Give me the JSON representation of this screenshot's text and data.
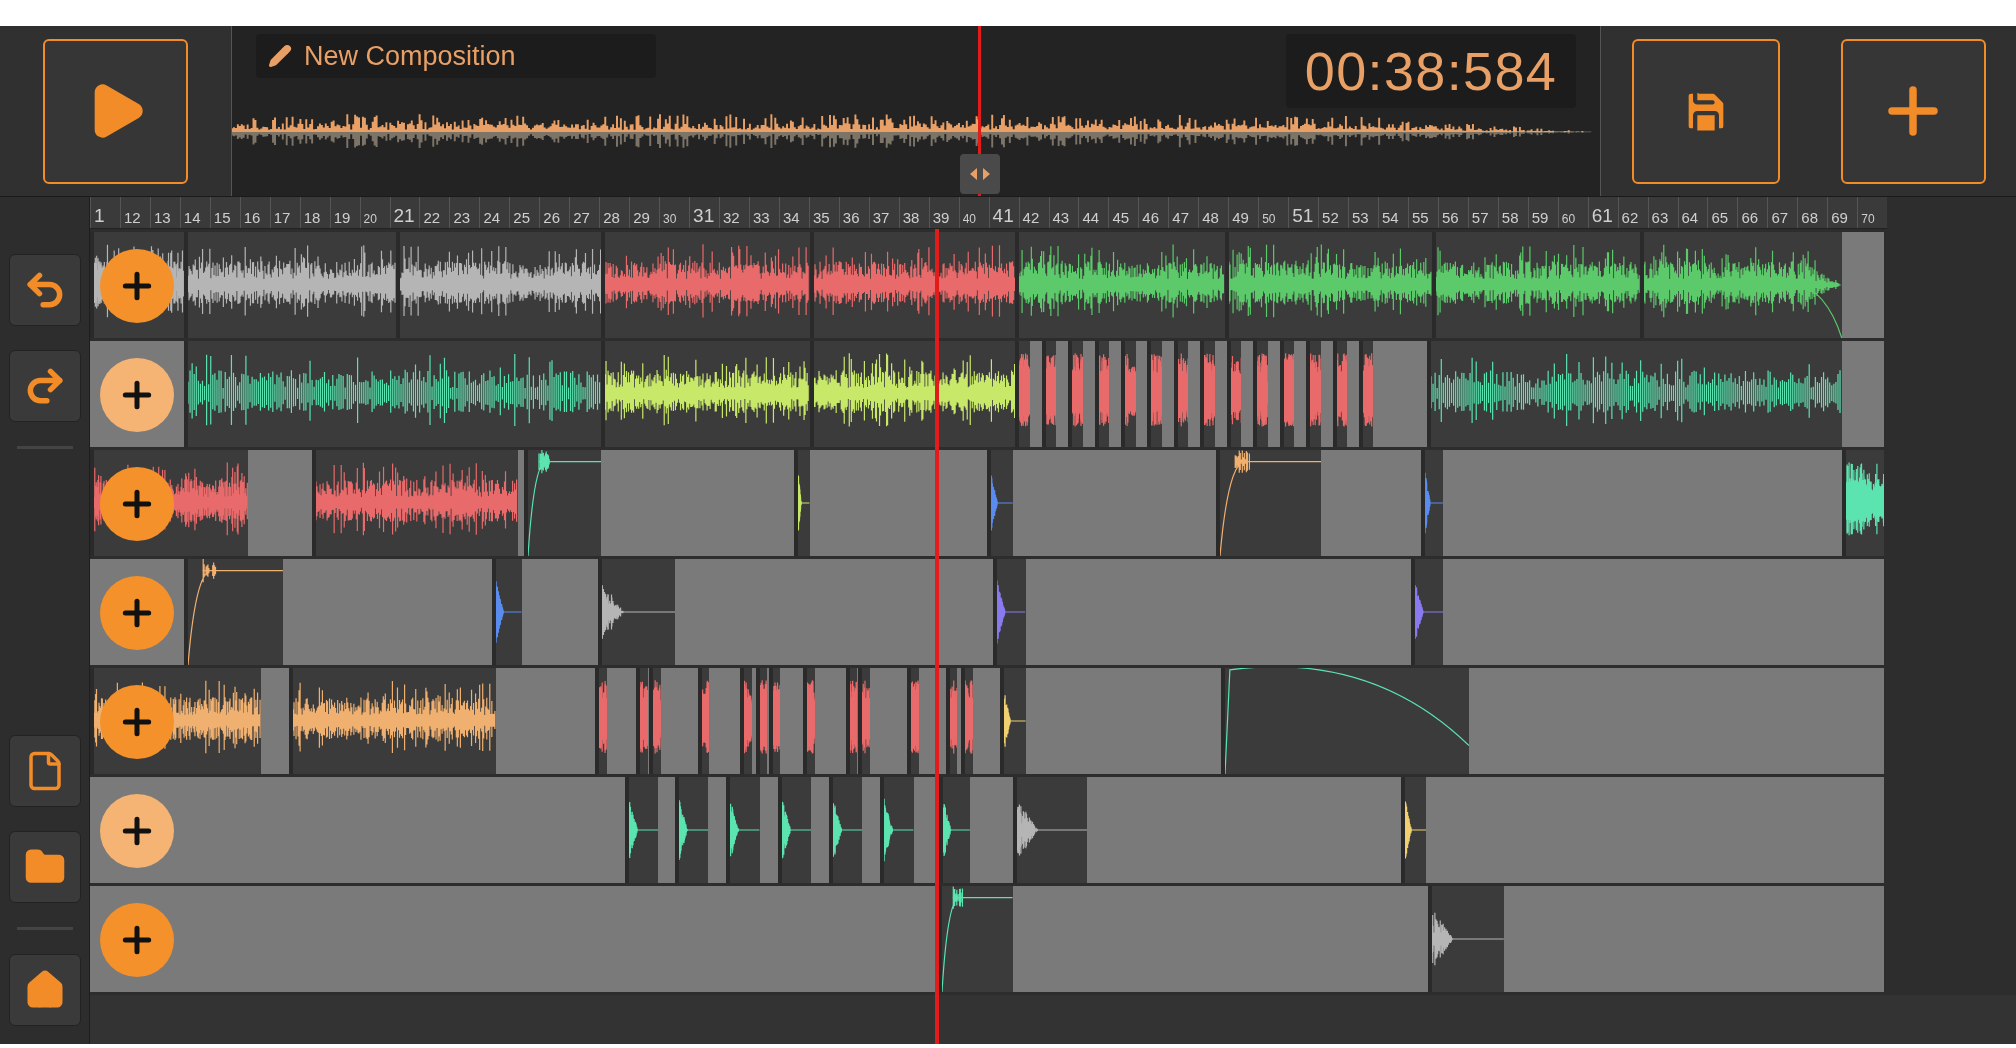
{
  "composition": {
    "title": "New Composition",
    "time": "00:38:584"
  },
  "ruler": [
    {
      "label": "1",
      "kind": "major"
    },
    {
      "label": "12",
      "kind": "minor"
    },
    {
      "label": "13",
      "kind": "minor"
    },
    {
      "label": "14",
      "kind": "minor"
    },
    {
      "label": "15",
      "kind": "minor"
    },
    {
      "label": "16",
      "kind": "minor"
    },
    {
      "label": "17",
      "kind": "minor"
    },
    {
      "label": "18",
      "kind": "minor"
    },
    {
      "label": "19",
      "kind": "minor"
    },
    {
      "label": "20",
      "kind": "small"
    },
    {
      "label": "21",
      "kind": "major"
    },
    {
      "label": "22",
      "kind": "minor"
    },
    {
      "label": "23",
      "kind": "minor"
    },
    {
      "label": "24",
      "kind": "minor"
    },
    {
      "label": "25",
      "kind": "minor"
    },
    {
      "label": "26",
      "kind": "minor"
    },
    {
      "label": "27",
      "kind": "minor"
    },
    {
      "label": "28",
      "kind": "minor"
    },
    {
      "label": "29",
      "kind": "minor"
    },
    {
      "label": "30",
      "kind": "small"
    },
    {
      "label": "31",
      "kind": "major"
    },
    {
      "label": "32",
      "kind": "minor"
    },
    {
      "label": "33",
      "kind": "minor"
    },
    {
      "label": "34",
      "kind": "minor"
    },
    {
      "label": "35",
      "kind": "minor"
    },
    {
      "label": "36",
      "kind": "minor"
    },
    {
      "label": "37",
      "kind": "minor"
    },
    {
      "label": "38",
      "kind": "minor"
    },
    {
      "label": "39",
      "kind": "minor"
    },
    {
      "label": "40",
      "kind": "small"
    },
    {
      "label": "41",
      "kind": "major"
    },
    {
      "label": "42",
      "kind": "minor"
    },
    {
      "label": "43",
      "kind": "minor"
    },
    {
      "label": "44",
      "kind": "minor"
    },
    {
      "label": "45",
      "kind": "minor"
    },
    {
      "label": "46",
      "kind": "minor"
    },
    {
      "label": "47",
      "kind": "minor"
    },
    {
      "label": "48",
      "kind": "minor"
    },
    {
      "label": "49",
      "kind": "minor"
    },
    {
      "label": "50",
      "kind": "small"
    },
    {
      "label": "51",
      "kind": "major"
    },
    {
      "label": "52",
      "kind": "minor"
    },
    {
      "label": "53",
      "kind": "minor"
    },
    {
      "label": "54",
      "kind": "minor"
    },
    {
      "label": "55",
      "kind": "minor"
    },
    {
      "label": "56",
      "kind": "minor"
    },
    {
      "label": "57",
      "kind": "minor"
    },
    {
      "label": "58",
      "kind": "minor"
    },
    {
      "label": "59",
      "kind": "minor"
    },
    {
      "label": "60",
      "kind": "small"
    },
    {
      "label": "61",
      "kind": "major"
    },
    {
      "label": "62",
      "kind": "minor"
    },
    {
      "label": "63",
      "kind": "minor"
    },
    {
      "label": "64",
      "kind": "minor"
    },
    {
      "label": "65",
      "kind": "minor"
    },
    {
      "label": "66",
      "kind": "minor"
    },
    {
      "label": "67",
      "kind": "minor"
    },
    {
      "label": "68",
      "kind": "minor"
    },
    {
      "label": "69",
      "kind": "minor"
    },
    {
      "label": "70",
      "kind": "small"
    }
  ],
  "tracks": [
    {
      "muted": false
    },
    {
      "muted": true
    },
    {
      "muted": false
    },
    {
      "muted": false
    },
    {
      "muted": false
    },
    {
      "muted": true
    },
    {
      "muted": false
    }
  ]
}
